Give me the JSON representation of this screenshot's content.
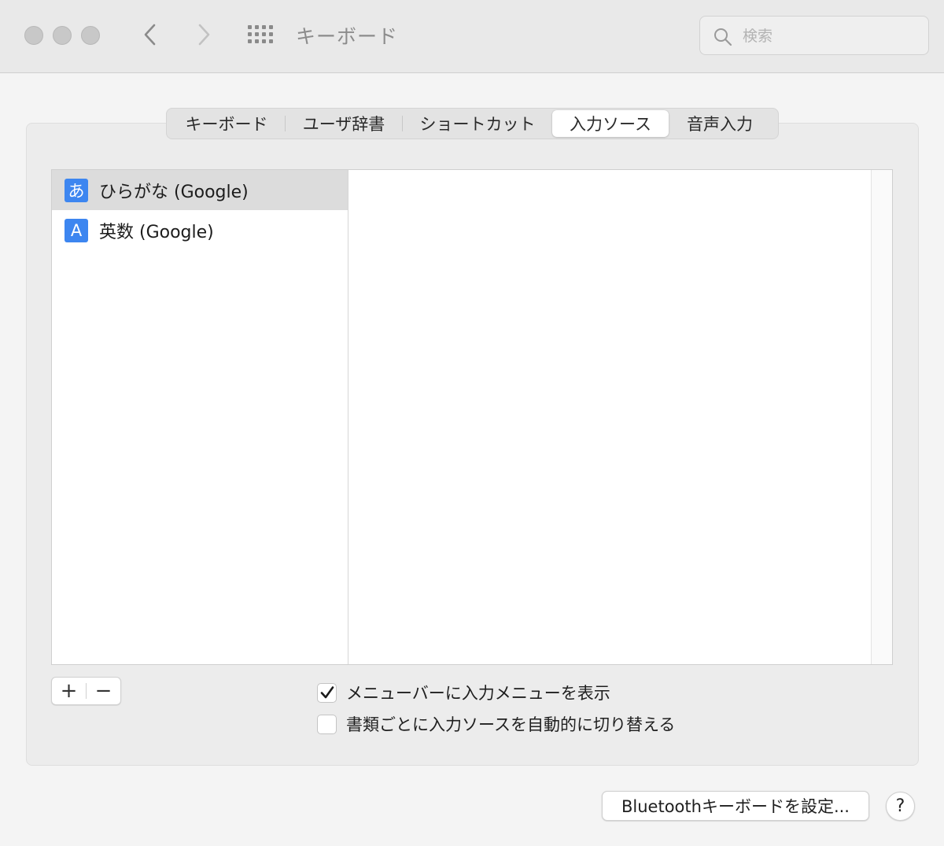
{
  "window": {
    "title": "キーボード"
  },
  "search": {
    "placeholder": "検索",
    "value": ""
  },
  "tabs": [
    {
      "label": "キーボード",
      "active": false
    },
    {
      "label": "ユーザ辞書",
      "active": false
    },
    {
      "label": "ショートカット",
      "active": false
    },
    {
      "label": "入力ソース",
      "active": true
    },
    {
      "label": "音声入力",
      "active": false
    }
  ],
  "input_sources": [
    {
      "icon_text": "あ",
      "label": "ひらがな (Google)",
      "selected": true
    },
    {
      "icon_text": "A",
      "label": "英数 (Google)",
      "selected": false
    }
  ],
  "add_remove": {
    "add_label": "+",
    "remove_label": "−"
  },
  "options": [
    {
      "label": "メニューバーに入力メニューを表示",
      "checked": true
    },
    {
      "label": "書類ごとに入力ソースを自動的に切り替える",
      "checked": false
    }
  ],
  "footer": {
    "bluetooth_button": "Bluetoothキーボードを設定...",
    "help_button": "?"
  },
  "colors": {
    "accent_icon": "#3d86f0",
    "selected_row": "#dcdcdc"
  }
}
